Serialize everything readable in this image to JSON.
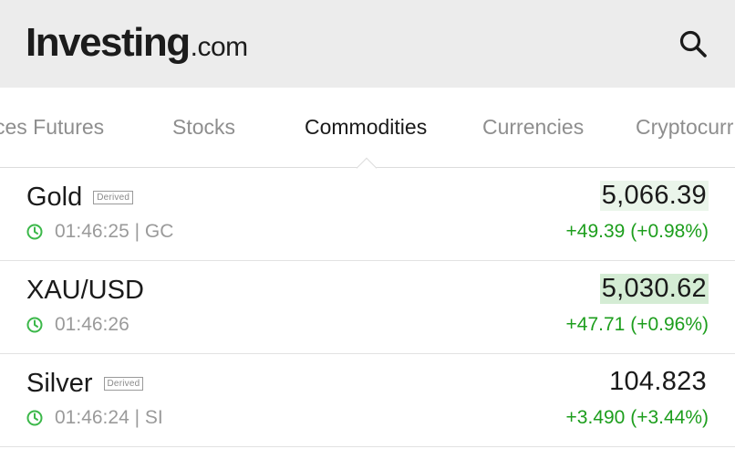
{
  "header": {
    "logo_main": "Investing",
    "logo_tld": ".com"
  },
  "tabs": [
    {
      "label": "ces Futures"
    },
    {
      "label": "Stocks"
    },
    {
      "label": "Commodities",
      "active": true
    },
    {
      "label": "Currencies"
    },
    {
      "label": "Cryptocurr"
    }
  ],
  "rows": [
    {
      "name": "Gold",
      "badge": "Derived",
      "time_symbol": "01:46:25 | GC",
      "price": "5,066.39",
      "change": "+49.39 (+0.98%)"
    },
    {
      "name": "XAU/USD",
      "badge": "",
      "time_symbol": "01:46:26",
      "price": "5,030.62",
      "change": "+47.71 (+0.96%)"
    },
    {
      "name": "Silver",
      "badge": "Derived",
      "time_symbol": "01:46:24 | SI",
      "price": "104.823",
      "change": "+3.490 (+3.44%)"
    }
  ],
  "colors": {
    "header_bg": "#ececec",
    "positive": "#1d9e1d",
    "price_highlight": "#d4ecd4",
    "clock": "#3cb84a"
  },
  "icons": {
    "search": "search-icon",
    "clock": "clock-icon"
  }
}
